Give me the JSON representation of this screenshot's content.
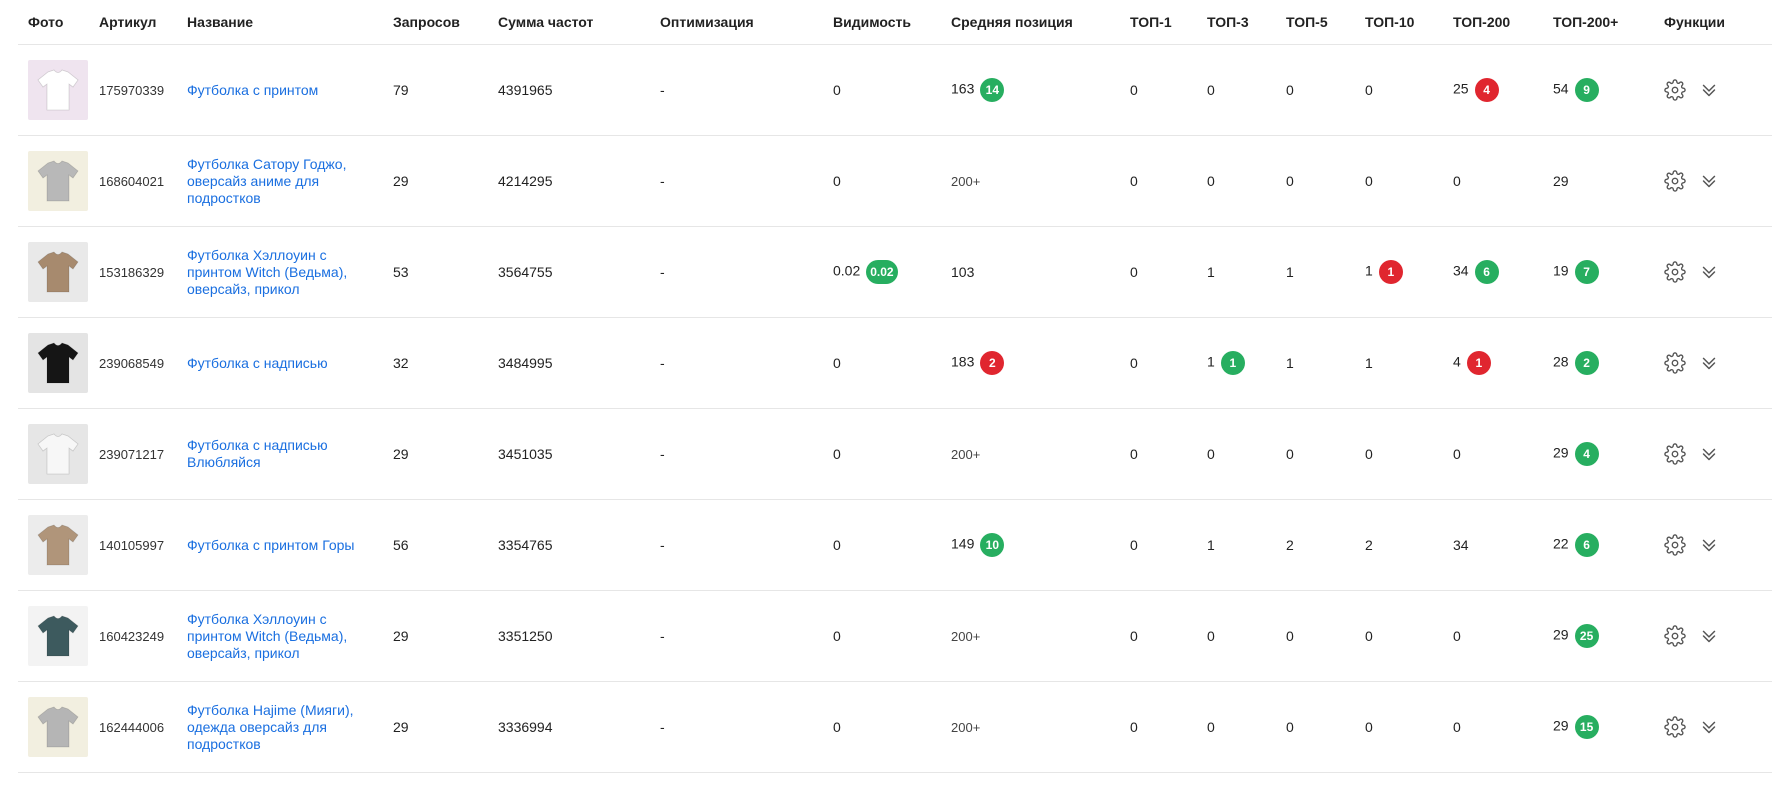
{
  "headers": {
    "photo": "Фото",
    "article": "Артикул",
    "name": "Название",
    "queries": "Запросов",
    "freq_sum": "Сумма частот",
    "optimization": "Оптимизация",
    "visibility": "Видимость",
    "avg_position": "Средняя позиция",
    "top1": "ТОП-1",
    "top3": "ТОП-3",
    "top5": "ТОП-5",
    "top10": "ТОП-10",
    "top200": "ТОП-200",
    "top200plus": "ТОП-200+",
    "functions": "Функции"
  },
  "icons": {
    "settings": "gear-icon",
    "expand": "double-chevron-down-icon"
  },
  "colors": {
    "link": "#1a6fe0",
    "badge_up": "#27ae60",
    "badge_down": "#e0262f"
  },
  "rows": [
    {
      "thumb_bg": "#efe4ef",
      "shirt": "#ffffff",
      "article": "175970339",
      "name": "Футболка с принтом",
      "queries": "79",
      "freq_sum": "4391965",
      "optimization": "-",
      "visibility": "0",
      "visibility_badge": "",
      "visibility_badge_color": "",
      "avg_position": "163",
      "avg_position_badge": "14",
      "avg_position_badge_color": "green",
      "top1": "0",
      "top3": "0",
      "top3_badge": "",
      "top3_badge_color": "",
      "top5": "0",
      "top10": "0",
      "top10_badge": "",
      "top10_badge_color": "",
      "top200": "25",
      "top200_badge": "4",
      "top200_badge_color": "red",
      "top200plus": "54",
      "top200plus_badge": "9",
      "top200plus_badge_color": "green"
    },
    {
      "thumb_bg": "#f2efe0",
      "shirt": "#b8b8b8",
      "article": "168604021",
      "name": "Футболка Сатору Годжо, оверсайз аниме для подростков",
      "queries": "29",
      "freq_sum": "4214295",
      "optimization": "-",
      "visibility": "0",
      "visibility_badge": "",
      "visibility_badge_color": "",
      "avg_position": "200+",
      "avg_position_badge": "",
      "avg_position_badge_color": "",
      "top1": "0",
      "top3": "0",
      "top3_badge": "",
      "top3_badge_color": "",
      "top5": "0",
      "top10": "0",
      "top10_badge": "",
      "top10_badge_color": "",
      "top200": "0",
      "top200_badge": "",
      "top200_badge_color": "",
      "top200plus": "29",
      "top200plus_badge": "",
      "top200plus_badge_color": ""
    },
    {
      "thumb_bg": "#e9e9e9",
      "shirt": "#a78a6e",
      "article": "153186329",
      "name": "Футболка Хэллоуин с принтом Witch (Ведьма), оверсайз, прикол",
      "queries": "53",
      "freq_sum": "3564755",
      "optimization": "-",
      "visibility": "0.02",
      "visibility_badge": "0.02",
      "visibility_badge_color": "green",
      "avg_position": "103",
      "avg_position_badge": "",
      "avg_position_badge_color": "",
      "top1": "0",
      "top3": "1",
      "top3_badge": "",
      "top3_badge_color": "",
      "top5": "1",
      "top10": "1",
      "top10_badge": "1",
      "top10_badge_color": "red",
      "top200": "34",
      "top200_badge": "6",
      "top200_badge_color": "green",
      "top200plus": "19",
      "top200plus_badge": "7",
      "top200plus_badge_color": "green"
    },
    {
      "thumb_bg": "#e4e4e4",
      "shirt": "#151515",
      "article": "239068549",
      "name": "Футболка с надписью",
      "queries": "32",
      "freq_sum": "3484995",
      "optimization": "-",
      "visibility": "0",
      "visibility_badge": "",
      "visibility_badge_color": "",
      "avg_position": "183",
      "avg_position_badge": "2",
      "avg_position_badge_color": "red",
      "top1": "0",
      "top3": "1",
      "top3_badge": "1",
      "top3_badge_color": "green",
      "top5": "1",
      "top10": "1",
      "top10_badge": "",
      "top10_badge_color": "",
      "top200": "4",
      "top200_badge": "1",
      "top200_badge_color": "red",
      "top200plus": "28",
      "top200plus_badge": "2",
      "top200plus_badge_color": "green"
    },
    {
      "thumb_bg": "#e6e6e6",
      "shirt": "#f7f7f7",
      "article": "239071217",
      "name": "Футболка с надписью Влюбляйся",
      "queries": "29",
      "freq_sum": "3451035",
      "optimization": "-",
      "visibility": "0",
      "visibility_badge": "",
      "visibility_badge_color": "",
      "avg_position": "200+",
      "avg_position_badge": "",
      "avg_position_badge_color": "",
      "top1": "0",
      "top3": "0",
      "top3_badge": "",
      "top3_badge_color": "",
      "top5": "0",
      "top10": "0",
      "top10_badge": "",
      "top10_badge_color": "",
      "top200": "0",
      "top200_badge": "",
      "top200_badge_color": "",
      "top200plus": "29",
      "top200plus_badge": "4",
      "top200plus_badge_color": "green"
    },
    {
      "thumb_bg": "#ececec",
      "shirt": "#b0957a",
      "article": "140105997",
      "name": "Футболка с принтом Горы",
      "queries": "56",
      "freq_sum": "3354765",
      "optimization": "-",
      "visibility": "0",
      "visibility_badge": "",
      "visibility_badge_color": "",
      "avg_position": "149",
      "avg_position_badge": "10",
      "avg_position_badge_color": "green",
      "top1": "0",
      "top3": "1",
      "top3_badge": "",
      "top3_badge_color": "",
      "top5": "2",
      "top10": "2",
      "top10_badge": "",
      "top10_badge_color": "",
      "top200": "34",
      "top200_badge": "",
      "top200_badge_color": "",
      "top200plus": "22",
      "top200plus_badge": "6",
      "top200plus_badge_color": "green"
    },
    {
      "thumb_bg": "#f3f3f3",
      "shirt": "#3d5a5e",
      "article": "160423249",
      "name": "Футболка Хэллоуин с принтом Witch (Ведьма), оверсайз, прикол",
      "queries": "29",
      "freq_sum": "3351250",
      "optimization": "-",
      "visibility": "0",
      "visibility_badge": "",
      "visibility_badge_color": "",
      "avg_position": "200+",
      "avg_position_badge": "",
      "avg_position_badge_color": "",
      "top1": "0",
      "top3": "0",
      "top3_badge": "",
      "top3_badge_color": "",
      "top5": "0",
      "top10": "0",
      "top10_badge": "",
      "top10_badge_color": "",
      "top200": "0",
      "top200_badge": "",
      "top200_badge_color": "",
      "top200plus": "29",
      "top200plus_badge": "25",
      "top200plus_badge_color": "green"
    },
    {
      "thumb_bg": "#f2efe0",
      "shirt": "#b5b5b5",
      "article": "162444006",
      "name": "Футболка Hajime (Мияги), одежда оверсайз для подростков",
      "queries": "29",
      "freq_sum": "3336994",
      "optimization": "-",
      "visibility": "0",
      "visibility_badge": "",
      "visibility_badge_color": "",
      "avg_position": "200+",
      "avg_position_badge": "",
      "avg_position_badge_color": "",
      "top1": "0",
      "top3": "0",
      "top3_badge": "",
      "top3_badge_color": "",
      "top5": "0",
      "top10": "0",
      "top10_badge": "",
      "top10_badge_color": "",
      "top200": "0",
      "top200_badge": "",
      "top200_badge_color": "",
      "top200plus": "29",
      "top200plus_badge": "15",
      "top200plus_badge_color": "green"
    }
  ]
}
